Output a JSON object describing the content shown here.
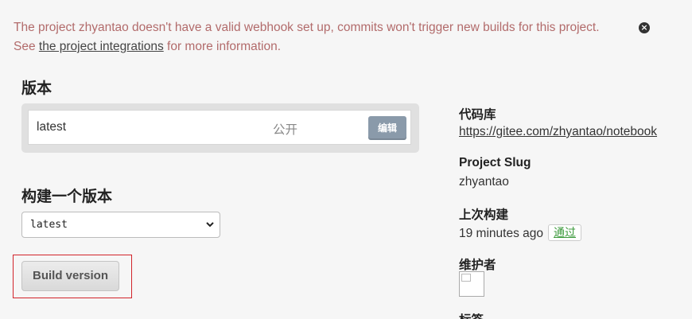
{
  "alert": {
    "line1": "The project zhyantao doesn't have a valid webhook set up, commits won't trigger new builds for this project.",
    "line2_prefix": "See ",
    "link_text": "the project integrations",
    "line2_suffix": " for more information.",
    "close_glyph": "×"
  },
  "versions": {
    "heading": "版本",
    "items": [
      {
        "name": "latest",
        "privacy": "公开",
        "edit_label": "编辑"
      }
    ]
  },
  "build": {
    "heading": "构建一个版本",
    "select_value": "latest",
    "button_label": "Build version"
  },
  "sidebar": {
    "repo_label": "代码库",
    "repo_url": "https://gitee.com/zhyantao/notebook",
    "slug_label": "Project Slug",
    "slug_value": "zhyantao",
    "last_build_label": "上次构建",
    "last_build_time": "19 minutes ago",
    "last_build_status": "通过",
    "maintainers_label": "维护者",
    "next_label": "标签"
  },
  "colors": {
    "alert_text": "#b26b6b",
    "highlight_border": "#d2232a",
    "status_passed": "#3c9a3c",
    "edit_button": "#8a9aaa"
  }
}
